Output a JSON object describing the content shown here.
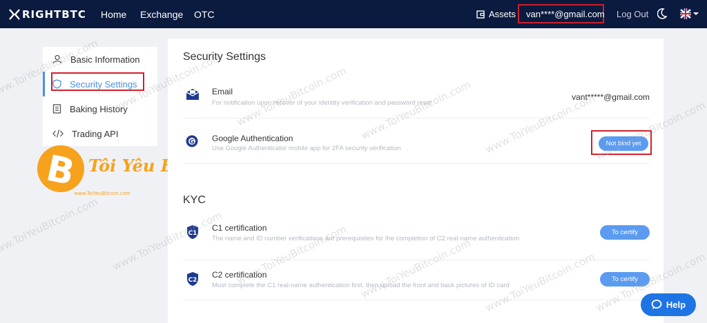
{
  "brand": {
    "logo_text": "RIGHTBTC"
  },
  "nav": {
    "items": [
      "Home",
      "Exchange",
      "OTC"
    ]
  },
  "header": {
    "assets_label": "Assets",
    "user_email": "van****@gmail.com",
    "logout_label": "Log Out"
  },
  "sidebar": {
    "items": [
      {
        "label": "Basic Information",
        "icon": "user-icon"
      },
      {
        "label": "Security Settings",
        "icon": "shield-icon",
        "active": true
      },
      {
        "label": "Baking History",
        "icon": "document-icon"
      },
      {
        "label": "Trading API",
        "icon": "code-icon"
      }
    ]
  },
  "watermark": {
    "logo_text": "Tôi Yêu BITCOIN",
    "logo_url": "www.ToiYeuBitcoin.com",
    "text": "www.ToiYeuBitcoin.com"
  },
  "security": {
    "title": "Security Settings",
    "email": {
      "title": "Email",
      "desc": "For notification upon recover of your identity verification and password reset",
      "value": "vant*****@gmail.com"
    },
    "google": {
      "title": "Google Authentication",
      "desc": "Use Google Authenticator mobile app for 2FA security verification",
      "button": "Not bind yet"
    }
  },
  "kyc": {
    "title": "KYC",
    "c1": {
      "title": "C1 certification",
      "desc": "The name and ID number verifications are prerequisites for the completion of C2 real-name authentication",
      "button": "To certify"
    },
    "c2": {
      "title": "C2 certification",
      "desc": "Must complete the C1 real-name authentication first, then upload the front and back pictures of ID card",
      "button": "To certify"
    }
  },
  "help": {
    "label": "Help"
  },
  "colors": {
    "header_bg": "#0b1a3f",
    "accent": "#4a90e2",
    "button": "#5b9bf0",
    "highlight": "#d0202a",
    "help_bg": "#1f74e4"
  }
}
